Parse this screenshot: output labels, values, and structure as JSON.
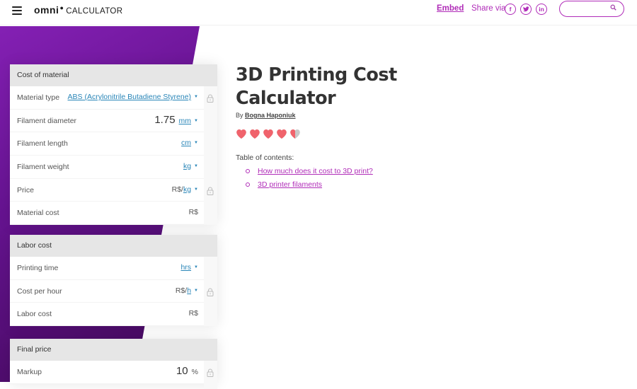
{
  "header": {
    "logo_main": "omni",
    "logo_sub": "CALCULATOR",
    "embed_label": "Embed",
    "share_label": "Share via",
    "social": [
      {
        "name": "facebook",
        "glyph": "f"
      },
      {
        "name": "twitter",
        "glyph": "t"
      },
      {
        "name": "linkedin",
        "glyph": "in"
      }
    ],
    "search_placeholder": ""
  },
  "colors": {
    "accent": "#b02cb8",
    "purple_bg_top": "#7a1aa6",
    "purple_bg_bottom": "#4e0f6e",
    "unit_link": "#2a86b8",
    "heart": "#f0636c",
    "heart_empty": "#c8c8c8"
  },
  "cards": {
    "material": {
      "title": "Cost of material",
      "rows": [
        {
          "label": "Material type",
          "value": "",
          "unit": "ABS (Acrylonitrile Butadiene Styrene)",
          "prefix": "",
          "locked": true
        },
        {
          "label": "Filament diameter",
          "value": "1.75",
          "unit": "mm",
          "prefix": "",
          "locked": false
        },
        {
          "label": "Filament length",
          "value": "",
          "unit": "cm",
          "prefix": "",
          "locked": false
        },
        {
          "label": "Filament weight",
          "value": "",
          "unit": "kg",
          "prefix": "",
          "locked": false
        },
        {
          "label": "Price",
          "value": "",
          "unit": "kg",
          "prefix": "R$/",
          "locked": true
        },
        {
          "label": "Material cost",
          "value": "",
          "unit": "",
          "prefix": "R$",
          "locked": false
        }
      ]
    },
    "labor": {
      "title": "Labor cost",
      "rows": [
        {
          "label": "Printing time",
          "value": "",
          "unit": "hrs",
          "prefix": "",
          "locked": false
        },
        {
          "label": "Cost per hour",
          "value": "",
          "unit": "h",
          "prefix": "R$/",
          "locked": true
        },
        {
          "label": "Labor cost",
          "value": "",
          "unit": "",
          "prefix": "R$",
          "locked": false
        }
      ]
    },
    "final": {
      "title": "Final price",
      "rows": [
        {
          "label": "Markup",
          "value": "10",
          "unit": "%",
          "prefix": "",
          "locked": true
        }
      ]
    }
  },
  "main": {
    "title_line1": "3D Printing Cost",
    "title_line2": "Calculator",
    "by_label": "By",
    "author": "Bogna Haponiuk",
    "rating": 4.5,
    "rating_max": 5,
    "toc_title": "Table of contents:",
    "toc": [
      "How much does it cost to 3D print?",
      "3D printer filaments"
    ]
  }
}
